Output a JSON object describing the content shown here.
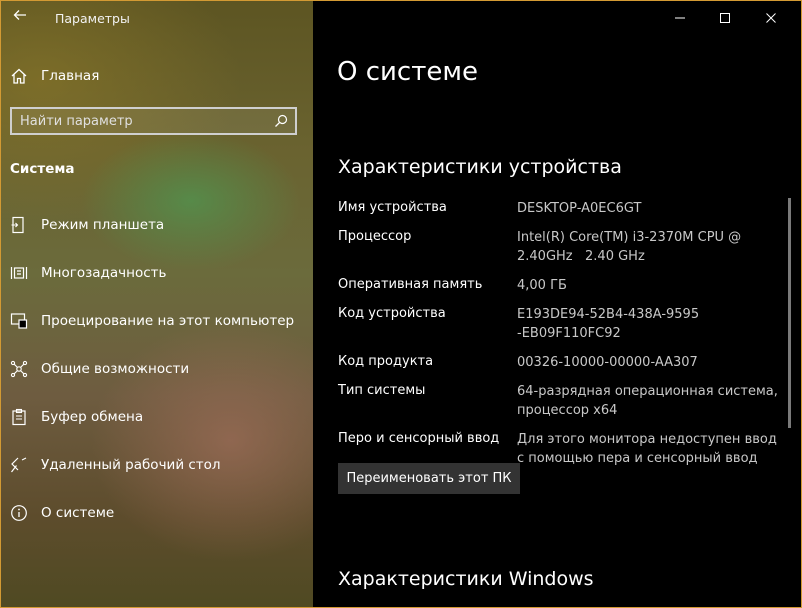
{
  "window": {
    "title": "Параметры",
    "accent": "#d39a33"
  },
  "sidebar": {
    "home_label": "Главная",
    "search_placeholder": "Найти параметр",
    "section": "Система",
    "items": [
      {
        "label": "Режим планшета",
        "icon": "tablet-mode-icon"
      },
      {
        "label": "Многозадачность",
        "icon": "multitasking-icon"
      },
      {
        "label": "Проецирование на этот компьютер",
        "icon": "projecting-icon"
      },
      {
        "label": "Общие возможности",
        "icon": "shared-experiences-icon"
      },
      {
        "label": "Буфер обмена",
        "icon": "clipboard-icon"
      },
      {
        "label": "Удаленный рабочий стол",
        "icon": "remote-desktop-icon"
      },
      {
        "label": "О системе",
        "icon": "about-info-icon"
      }
    ]
  },
  "main": {
    "title": "О системе",
    "device_section": "Характеристики устройства",
    "specs": [
      {
        "key": "Имя устройства",
        "value": "DESKTOP-A0EC6GT"
      },
      {
        "key": "Процессор",
        "value": "Intel(R) Core(TM) i3-2370M CPU @ 2.40GHz   2.40 GHz"
      },
      {
        "key": "Оперативная память",
        "value": "4,00 ГБ"
      },
      {
        "key": "Код устройства",
        "value": "E193DE94-52B4-438A-9595-EB09F110FC92"
      },
      {
        "key": "Код продукта",
        "value": "00326-10000-00000-AA307"
      },
      {
        "key": "Тип системы",
        "value": "64-разрядная операционная система, процессор x64"
      },
      {
        "key": "Перо и сенсорный ввод",
        "value": "Для этого монитора недоступен ввод с помощью пера и сенсорный ввод"
      }
    ],
    "rename_button": "Переименовать этот ПК",
    "windows_section": "Характеристики Windows"
  }
}
